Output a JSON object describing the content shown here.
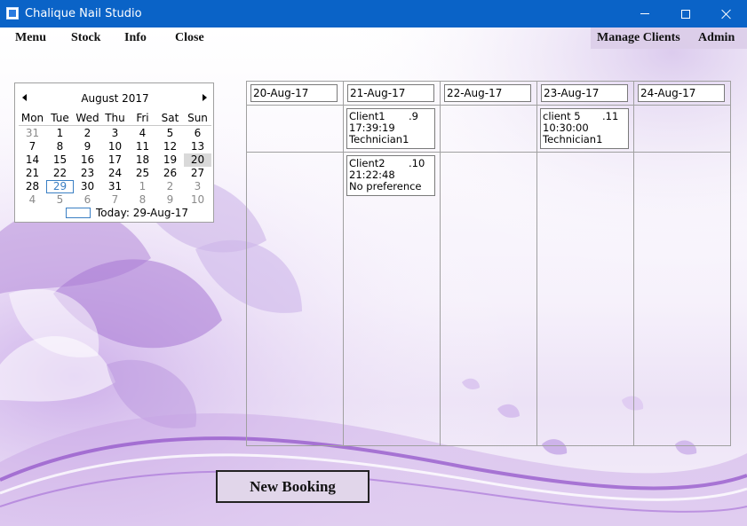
{
  "window": {
    "title": "Chalique Nail Studio"
  },
  "menu": {
    "left": [
      "Menu",
      "Stock",
      "Info",
      "Close"
    ],
    "manage_clients": "Manage Clients",
    "admin": "Admin"
  },
  "calendar": {
    "month_title": "August 2017",
    "weekdays": [
      "Mon",
      "Tue",
      "Wed",
      "Thu",
      "Fri",
      "Sat",
      "Sun"
    ],
    "weeks": [
      [
        "31",
        "1",
        "2",
        "3",
        "4",
        "5",
        "6"
      ],
      [
        "7",
        "8",
        "9",
        "10",
        "11",
        "12",
        "13"
      ],
      [
        "14",
        "15",
        "16",
        "17",
        "18",
        "19",
        "20"
      ],
      [
        "21",
        "22",
        "23",
        "24",
        "25",
        "26",
        "27"
      ],
      [
        "28",
        "29",
        "30",
        "31",
        "1",
        "2",
        "3"
      ],
      [
        "4",
        "5",
        "6",
        "7",
        "8",
        "9",
        "10"
      ]
    ],
    "selected_day": "20",
    "today_day": "29",
    "today_label": "Today: 29-Aug-17"
  },
  "schedule": {
    "dates": [
      "20-Aug-17",
      "21-Aug-17",
      "22-Aug-17",
      "23-Aug-17",
      "24-Aug-17"
    ],
    "bookings": [
      {
        "day": "21-Aug-17",
        "client": "Client1",
        "number": ".9",
        "time": "17:39:19",
        "technician": "Technician1"
      },
      {
        "day": "21-Aug-17",
        "client": "Client2",
        "number": ".10",
        "time": "21:22:48",
        "technician": "No preference"
      },
      {
        "day": "23-Aug-17",
        "client": "client 5",
        "number": ".11",
        "time": "10:30:00",
        "technician": "Technician1"
      }
    ]
  },
  "actions": {
    "new_booking": "New Booking"
  },
  "colors": {
    "titlebar": "#0a63c7",
    "accent_purple": "#9b6fc9",
    "button_bg": "#e1d6ea"
  }
}
